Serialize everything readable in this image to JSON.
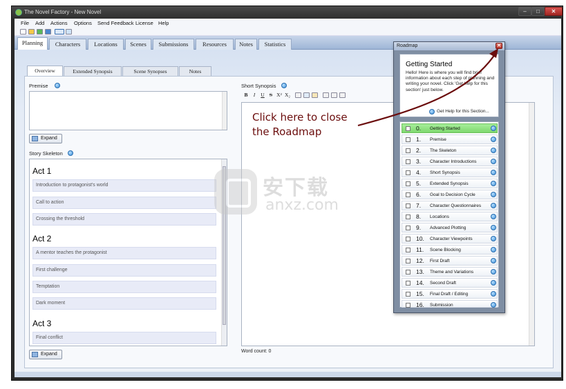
{
  "window": {
    "title": "The Novel Factory - New Novel",
    "close_glyph": "✕",
    "min_glyph": "–",
    "max_glyph": "□"
  },
  "menu": [
    "File",
    "Add",
    "Actions",
    "Options",
    "Send Feedback",
    "License",
    "Help"
  ],
  "main_tabs": [
    "Planning",
    "Characters",
    "Locations",
    "Scenes",
    "Submissions",
    "Resources",
    "Notes",
    "Statistics"
  ],
  "sub_tabs": [
    "Overview",
    "Extended Synopsis",
    "Scene Synopses",
    "Notes"
  ],
  "premise": {
    "label": "Premise",
    "expand_label": "Expand"
  },
  "skeleton": {
    "label": "Story Skeleton",
    "expand_label": "Expand",
    "acts": [
      {
        "title": "Act 1",
        "scenes": [
          "Introduction to protagonist's world",
          "Call to action",
          "Crossing the threshold"
        ]
      },
      {
        "title": "Act 2",
        "scenes": [
          "A mentor teaches the protagonist",
          "First challenge",
          "Temptation",
          "Dark moment"
        ]
      },
      {
        "title": "Act 3",
        "scenes": [
          "Final conflict"
        ]
      }
    ]
  },
  "synopsis": {
    "label": "Short Synopsis",
    "format_buttons": [
      "B",
      "I",
      "U",
      "S",
      "X²",
      "X₂"
    ],
    "word_count": "Word count: 0"
  },
  "annotation": "Click here to close\nthe Roadmap",
  "watermark": {
    "cn": "安下载",
    "en": "anxz.com"
  },
  "roadmap": {
    "title": "Roadmap",
    "close_glyph": "✕",
    "info_title": "Getting Started",
    "info_text": "Hello! Here is where you will find brief information about each step of planning and writing your novel. Click 'Get help for this section' just below.",
    "get_help": "Get Help for this Section...",
    "steps": [
      {
        "num": "0.",
        "name": "Getting Started"
      },
      {
        "num": "1.",
        "name": "Premise"
      },
      {
        "num": "2.",
        "name": "The Skeleton"
      },
      {
        "num": "3.",
        "name": "Character Introductions"
      },
      {
        "num": "4.",
        "name": "Short Synopsis"
      },
      {
        "num": "5.",
        "name": "Extended Synopsis"
      },
      {
        "num": "6.",
        "name": "Goal to Decision Cycle"
      },
      {
        "num": "7.",
        "name": "Character Questionnaires"
      },
      {
        "num": "8.",
        "name": "Locations"
      },
      {
        "num": "9.",
        "name": "Advanced Plotting"
      },
      {
        "num": "10.",
        "name": "Character Viewpoints"
      },
      {
        "num": "11.",
        "name": "Scene Blocking"
      },
      {
        "num": "12.",
        "name": "First Draft"
      },
      {
        "num": "13.",
        "name": "Theme and Variations"
      },
      {
        "num": "14.",
        "name": "Second Draft"
      },
      {
        "num": "15.",
        "name": "Final Draft / Editing"
      },
      {
        "num": "16.",
        "name": "Submission"
      }
    ]
  },
  "colors": {
    "accent": "#3a8fd8",
    "current_step": "#7fd86e",
    "annotation": "#6b0d0d",
    "titlebar": "#2f2f2f"
  }
}
